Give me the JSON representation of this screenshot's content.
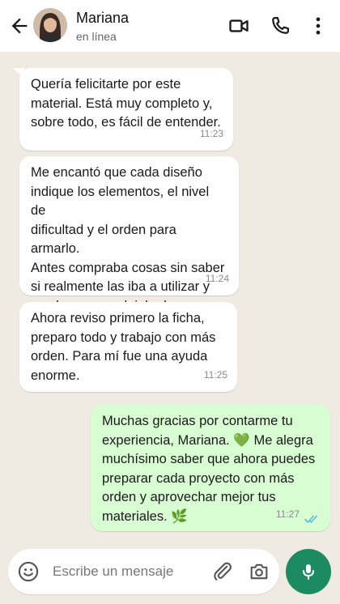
{
  "header": {
    "contact_name": "Mariana",
    "status": "en línea",
    "icons": [
      "back-arrow-icon",
      "video-call-icon",
      "phone-icon",
      "more-options-icon"
    ]
  },
  "messages": [
    {
      "direction": "in",
      "text": "Quería felicitarte por este\nmaterial. Está muy completo y,\nsobre todo, es fácil de entender.",
      "time": "11:23"
    },
    {
      "direction": "in",
      "text": "Me encantó que cada diseño\nindique los elementos, el nivel de\ndificultad y el orden para armarlo.\nAntes compraba cosas sin saber\nsi realmente las iba a utilizar y\nmuchas veces dejaba los\nproyectos a medias.",
      "time": "11:24"
    },
    {
      "direction": "in",
      "text": "Ahora reviso primero la ficha,\npreparo todo y trabajo con más\norden. Para mí fue una ayuda\nenorme.",
      "time": "11:25"
    },
    {
      "direction": "out",
      "text": "Muchas gracias por contarme tu\nexperiencia, Mariana. 💚 Me alegra\nmuchísimo saber que ahora puedes\npreparar cada proyecto con más\norden y aprovechar mejor tus\nmateriales. 🌿",
      "time": "11:27",
      "status": "read"
    }
  ],
  "composer": {
    "placeholder": "Escribe un mensaje",
    "icons": [
      "emoji-icon",
      "attach-icon",
      "camera-icon",
      "mic-icon"
    ]
  },
  "colors": {
    "background": "#efeae2",
    "incoming_bubble": "#ffffff",
    "outgoing_bubble": "#d9fdd3",
    "accent_green": "#1c8a63",
    "read_ticks": "#53bdeb"
  }
}
